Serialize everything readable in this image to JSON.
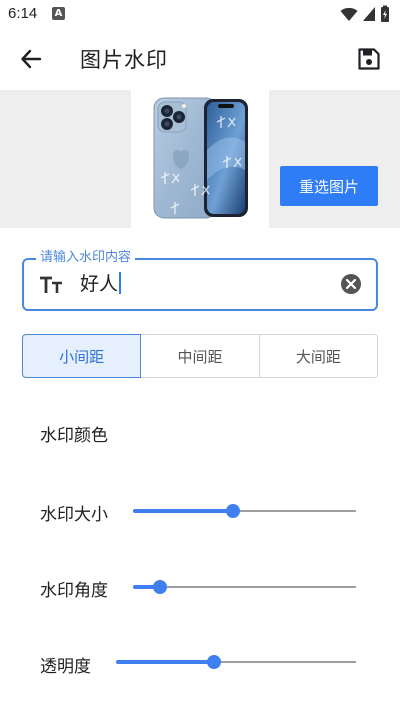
{
  "status_bar": {
    "time": "6:14",
    "notification_letter": "A"
  },
  "app_bar": {
    "title": "图片水印"
  },
  "preview": {
    "reselect_label": "重选图片",
    "watermark_text": "好人"
  },
  "input": {
    "label": "请输入水印内容",
    "value": "好人"
  },
  "spacing": {
    "options": [
      "小间距",
      "中间距",
      "大间距"
    ],
    "selected": "小间距"
  },
  "settings": {
    "color_label": "水印颜色",
    "size_label": "水印大小",
    "size_value": 0.45,
    "angle_label": "水印角度",
    "angle_value": 0.12,
    "opacity_label": "透明度",
    "opacity_value": 0.41
  },
  "colors": {
    "accent": "#2e7cf6",
    "track": "#9e9e9e",
    "selected_bg": "#e6f0fd"
  }
}
